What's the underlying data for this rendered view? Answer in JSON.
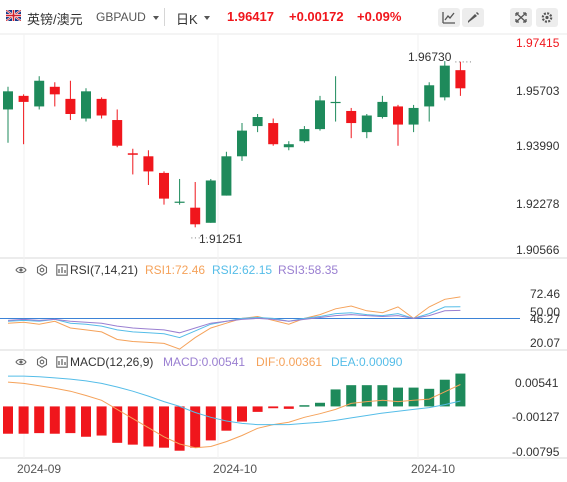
{
  "header": {
    "pair_cn": "英镑/澳元",
    "symbol": "GBPAUD",
    "period": "日K",
    "price": "1.96417",
    "change": "+0.00172",
    "change_pct": "+0.09%",
    "buttons": [
      "line-chart-icon",
      "pencil-icon",
      "fullscreen-icon",
      "settings-icon"
    ]
  },
  "price_panel": {
    "y_ticks": [
      "1.97415",
      "1.95703",
      "1.93990",
      "1.92278",
      "1.90566"
    ],
    "high_label": "1.96730",
    "low_label": "1.91251"
  },
  "rsi": {
    "title": "RSI(7,14,21)",
    "rsi1": "RSI1:72.46",
    "rsi2": "RSI2:62.15",
    "rsi3": "RSI3:58.35",
    "ticks": [
      "72.46",
      "50.00",
      "46.27",
      "20.07"
    ]
  },
  "macd": {
    "title": "MACD(12,26,9)",
    "macd": "MACD:0.00541",
    "dif": "DIF:0.00361",
    "dea": "DEA:0.00090",
    "ticks": [
      "0.00541",
      "-0.00127",
      "-0.00795"
    ]
  },
  "x_axis": [
    "2024-09",
    "2024-10",
    "2024-10"
  ],
  "colors": {
    "up": "#1e8a5b",
    "down": "#f0161c",
    "rsi1": "#f5a25a",
    "rsi2": "#55bde8",
    "rsi3": "#9a7fd1",
    "dif": "#f5a25a",
    "dea": "#55bde8"
  },
  "candles": [
    {
      "o": 1.9515,
      "h": 1.959,
      "l": 1.9405,
      "c": 1.9575
    },
    {
      "o": 1.956,
      "h": 1.9565,
      "l": 1.94,
      "c": 1.954
    },
    {
      "o": 1.9525,
      "h": 1.9625,
      "l": 1.9515,
      "c": 1.961
    },
    {
      "o": 1.959,
      "h": 1.9605,
      "l": 1.9525,
      "c": 1.9565
    },
    {
      "o": 1.955,
      "h": 1.961,
      "l": 1.948,
      "c": 1.95
    },
    {
      "o": 1.9485,
      "h": 1.9585,
      "l": 1.9475,
      "c": 1.9575
    },
    {
      "o": 1.955,
      "h": 1.9555,
      "l": 1.9485,
      "c": 1.9495
    },
    {
      "o": 1.948,
      "h": 1.9515,
      "l": 1.939,
      "c": 1.9395
    },
    {
      "o": 1.937,
      "h": 1.9385,
      "l": 1.93,
      "c": 1.9365
    },
    {
      "o": 1.936,
      "h": 1.938,
      "l": 1.9265,
      "c": 1.931
    },
    {
      "o": 1.9305,
      "h": 1.931,
      "l": 1.92,
      "c": 1.922
    },
    {
      "o": 1.921,
      "h": 1.9285,
      "l": 1.92,
      "c": 1.921
    },
    {
      "o": 1.919,
      "h": 1.9275,
      "l": 1.9125,
      "c": 1.9135
    },
    {
      "o": 1.914,
      "h": 1.9285,
      "l": 1.914,
      "c": 1.928
    },
    {
      "o": 1.923,
      "h": 1.9375,
      "l": 1.923,
      "c": 1.936
    },
    {
      "o": 1.936,
      "h": 1.947,
      "l": 1.9345,
      "c": 1.9445
    },
    {
      "o": 1.946,
      "h": 1.95,
      "l": 1.944,
      "c": 1.949
    },
    {
      "o": 1.947,
      "h": 1.9485,
      "l": 1.9395,
      "c": 1.94
    },
    {
      "o": 1.939,
      "h": 1.941,
      "l": 1.938,
      "c": 1.94
    },
    {
      "o": 1.941,
      "h": 1.946,
      "l": 1.9405,
      "c": 1.945
    },
    {
      "o": 1.945,
      "h": 1.956,
      "l": 1.9445,
      "c": 1.9545
    },
    {
      "o": 1.954,
      "h": 1.9625,
      "l": 1.9475,
      "c": 1.954
    },
    {
      "o": 1.951,
      "h": 1.952,
      "l": 1.942,
      "c": 1.947
    },
    {
      "o": 1.944,
      "h": 1.95,
      "l": 1.942,
      "c": 1.9495
    },
    {
      "o": 1.949,
      "h": 1.956,
      "l": 1.9485,
      "c": 1.954
    },
    {
      "o": 1.9525,
      "h": 1.953,
      "l": 1.9395,
      "c": 1.9465
    },
    {
      "o": 1.9465,
      "h": 1.953,
      "l": 1.944,
      "c": 1.952
    },
    {
      "o": 1.9525,
      "h": 1.9605,
      "l": 1.9475,
      "c": 1.9595
    },
    {
      "o": 1.9555,
      "h": 1.9675,
      "l": 1.9545,
      "c": 1.966
    },
    {
      "o": 1.9645,
      "h": 1.9673,
      "l": 1.956,
      "c": 1.9585
    }
  ],
  "rsi_series": {
    "rsi1": [
      45,
      46,
      44,
      47,
      40,
      38,
      36,
      28,
      26,
      25,
      24,
      18,
      30,
      40,
      45,
      50,
      52,
      48,
      44,
      50,
      54,
      60,
      63,
      58,
      56,
      62,
      50,
      62,
      70,
      72.46
    ],
    "rsi2": [
      47,
      48,
      47,
      49,
      45,
      44,
      42,
      38,
      36,
      35,
      34,
      30,
      37,
      44,
      47,
      50,
      51,
      50,
      47,
      50,
      52,
      55,
      56,
      54,
      53,
      55,
      50,
      55,
      62,
      62.15
    ],
    "rsi3": [
      48,
      49,
      48,
      49,
      47,
      46,
      45,
      42,
      40,
      39,
      38,
      35,
      40,
      45,
      47,
      49,
      50,
      49,
      47,
      49,
      51,
      53,
      54,
      53,
      52,
      53,
      50,
      53,
      58,
      58.35
    ]
  },
  "macd_hist": [
    -0.0045,
    -0.0045,
    -0.0044,
    -0.0045,
    -0.0044,
    -0.005,
    -0.0048,
    -0.006,
    -0.0063,
    -0.0066,
    -0.0068,
    -0.0073,
    -0.0068,
    -0.0056,
    -0.004,
    -0.0025,
    -0.0009,
    -0.0003,
    -0.0004,
    0.0002,
    0.0006,
    0.0028,
    0.0035,
    0.0035,
    0.0035,
    0.0031,
    0.0031,
    0.0029,
    0.0044,
    0.00541
  ],
  "dif_series": [
    0.004,
    0.0038,
    0.0034,
    0.003,
    0.0025,
    0.0018,
    0.001,
    -0.0005,
    -0.002,
    -0.0035,
    -0.005,
    -0.0062,
    -0.0068,
    -0.0066,
    -0.0058,
    -0.0048,
    -0.0036,
    -0.003,
    -0.0026,
    -0.0018,
    -0.0012,
    -0.0005,
    0.0005,
    0.0008,
    0.001,
    0.0008,
    0.001,
    0.0012,
    0.0024,
    0.00361
  ],
  "dea_series": [
    0.005,
    0.005,
    0.0049,
    0.0047,
    0.0045,
    0.0042,
    0.0038,
    0.0032,
    0.0025,
    0.0017,
    0.0008,
    0.0,
    -0.001,
    -0.0018,
    -0.0024,
    -0.0028,
    -0.003,
    -0.003,
    -0.003,
    -0.0028,
    -0.0026,
    -0.0023,
    -0.0019,
    -0.0015,
    -0.0011,
    -0.0008,
    -0.0005,
    -0.0002,
    0.0003,
    0.0009
  ]
}
